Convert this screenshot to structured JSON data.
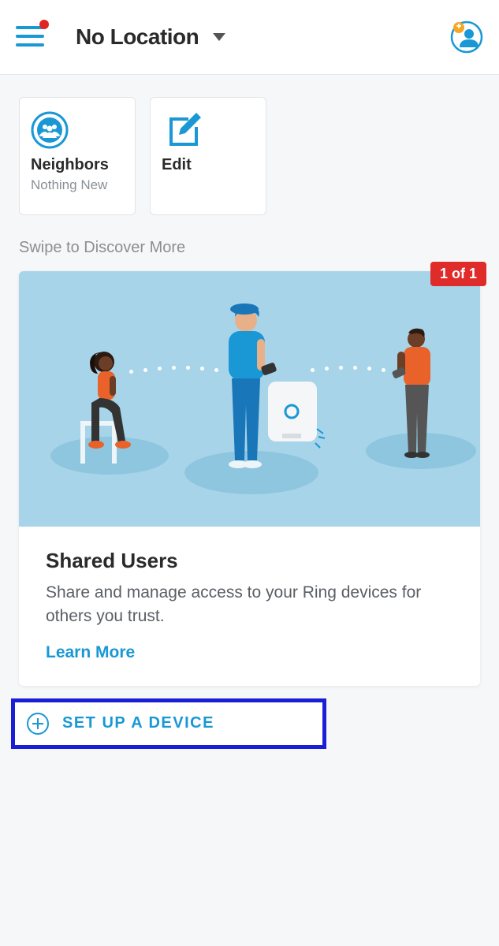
{
  "header": {
    "location_label": "No Location"
  },
  "tiles": {
    "neighbors": {
      "title": "Neighbors",
      "subtitle": "Nothing New"
    },
    "edit": {
      "title": "Edit"
    }
  },
  "discover": {
    "section_label": "Swipe to Discover More",
    "badge": "1 of 1",
    "card_title": "Shared Users",
    "card_desc": "Share and manage access to your Ring devices for others you trust.",
    "learn_more": "Learn More"
  },
  "setup": {
    "label": "SET UP A DEVICE"
  }
}
